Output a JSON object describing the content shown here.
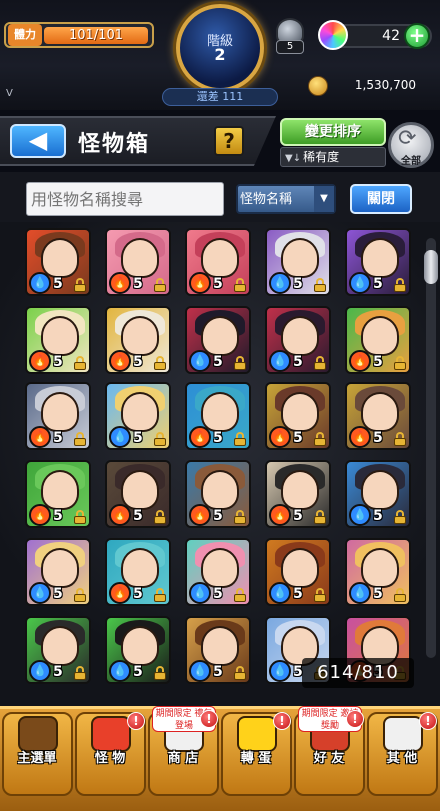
{
  "status": {
    "stamina_icon_label": "體力",
    "stamina": "101/101",
    "rank_label": "階級",
    "rank_value": "2",
    "exp_text": "還差 111",
    "potion_count": "5",
    "orb_count": "42",
    "plus_label": "+",
    "version": "V",
    "gold": "1,530,700"
  },
  "header": {
    "back_glyph": "◀",
    "title": "怪物箱",
    "help_label": "?",
    "sort_button": "變更排序",
    "sort_value": "稀有度",
    "all_label": "全部"
  },
  "search": {
    "placeholder": "用怪物名稱搜尋",
    "filter_value": "怪物名稱",
    "filter_chevron": "▼",
    "close_label": "關閉"
  },
  "box_count": "614/810",
  "grid": [
    [
      {
        "attr": "water",
        "lv": "5"
      },
      {
        "attr": "fire",
        "lv": "5"
      },
      {
        "attr": "fire",
        "lv": "5"
      },
      {
        "attr": "water",
        "lv": "5"
      },
      {
        "attr": "water",
        "lv": "5"
      }
    ],
    [
      {
        "attr": "fire",
        "lv": "5"
      },
      {
        "attr": "fire",
        "lv": "5"
      },
      {
        "attr": "water",
        "lv": "5"
      },
      {
        "attr": "water",
        "lv": "5"
      },
      {
        "attr": "fire",
        "lv": "5"
      }
    ],
    [
      {
        "attr": "fire",
        "lv": "5"
      },
      {
        "attr": "water",
        "lv": "5"
      },
      {
        "attr": "fire",
        "lv": "5"
      },
      {
        "attr": "fire",
        "lv": "5"
      },
      {
        "attr": "fire",
        "lv": "5"
      }
    ],
    [
      {
        "attr": "fire",
        "lv": "5"
      },
      {
        "attr": "fire",
        "lv": "5"
      },
      {
        "attr": "fire",
        "lv": "5"
      },
      {
        "attr": "fire",
        "lv": "5"
      },
      {
        "attr": "water",
        "lv": "5"
      }
    ],
    [
      {
        "attr": "water",
        "lv": "5"
      },
      {
        "attr": "fire",
        "lv": "5"
      },
      {
        "attr": "water",
        "lv": "5"
      },
      {
        "attr": "water",
        "lv": "5"
      },
      {
        "attr": "water",
        "lv": "5"
      }
    ],
    [
      {
        "attr": "water",
        "lv": "5"
      },
      {
        "attr": "water",
        "lv": "5"
      },
      {
        "attr": "water",
        "lv": "5"
      },
      {
        "attr": "water",
        "lv": "5"
      },
      {
        "attr": "fire",
        "lv": "5"
      }
    ]
  ],
  "menu": [
    {
      "label": "主選單",
      "icon": "castle-icon"
    },
    {
      "label": "怪 物",
      "icon": "monster-icon"
    },
    {
      "label": "商 店",
      "icon": "shop-icon",
      "notice": "期間限定 禮包登場"
    },
    {
      "label": "轉 蛋",
      "icon": "gacha-icon"
    },
    {
      "label": "好 友",
      "icon": "friends-icon",
      "notice": "期間限定 邀請獎勵"
    },
    {
      "label": "其 他",
      "icon": "other-icon"
    }
  ],
  "alert_glyph": "!",
  "colors": {
    "accent_gold": "#d9a642",
    "fire": "#ff5a1f",
    "water": "#2f8cff",
    "wood": "#3fbf3a",
    "menu_bg": "#e6a33a"
  }
}
